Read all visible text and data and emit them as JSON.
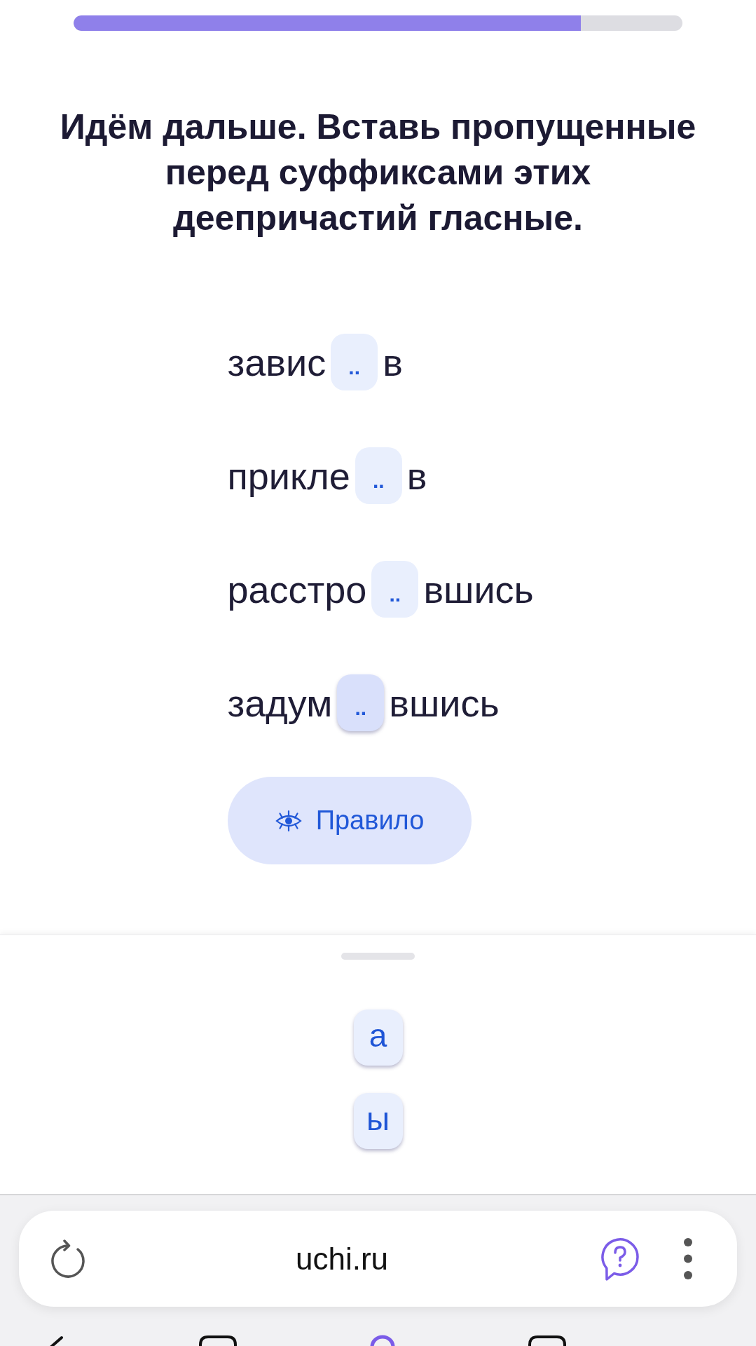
{
  "progress": {
    "level": 0.833
  },
  "title": "Идём дальше. Вставь пропущенные перед суффиксами этих деепричастий гласные.",
  "exercises": [
    {
      "prefix": "завис",
      "placeholder": "..",
      "suffix": "в",
      "selected": false
    },
    {
      "prefix": "прикле",
      "placeholder": "..",
      "suffix": "в",
      "selected": false
    },
    {
      "prefix": "расстро",
      "placeholder": "..",
      "suffix": "вшись",
      "selected": false
    },
    {
      "prefix": "задум",
      "placeholder": "..",
      "suffix": "вшись",
      "selected": true
    }
  ],
  "rule_button": {
    "label": "Правило"
  },
  "letter_options": [
    {
      "label": "а"
    },
    {
      "label": "ы"
    }
  ],
  "browser": {
    "url": "uchi.ru"
  }
}
